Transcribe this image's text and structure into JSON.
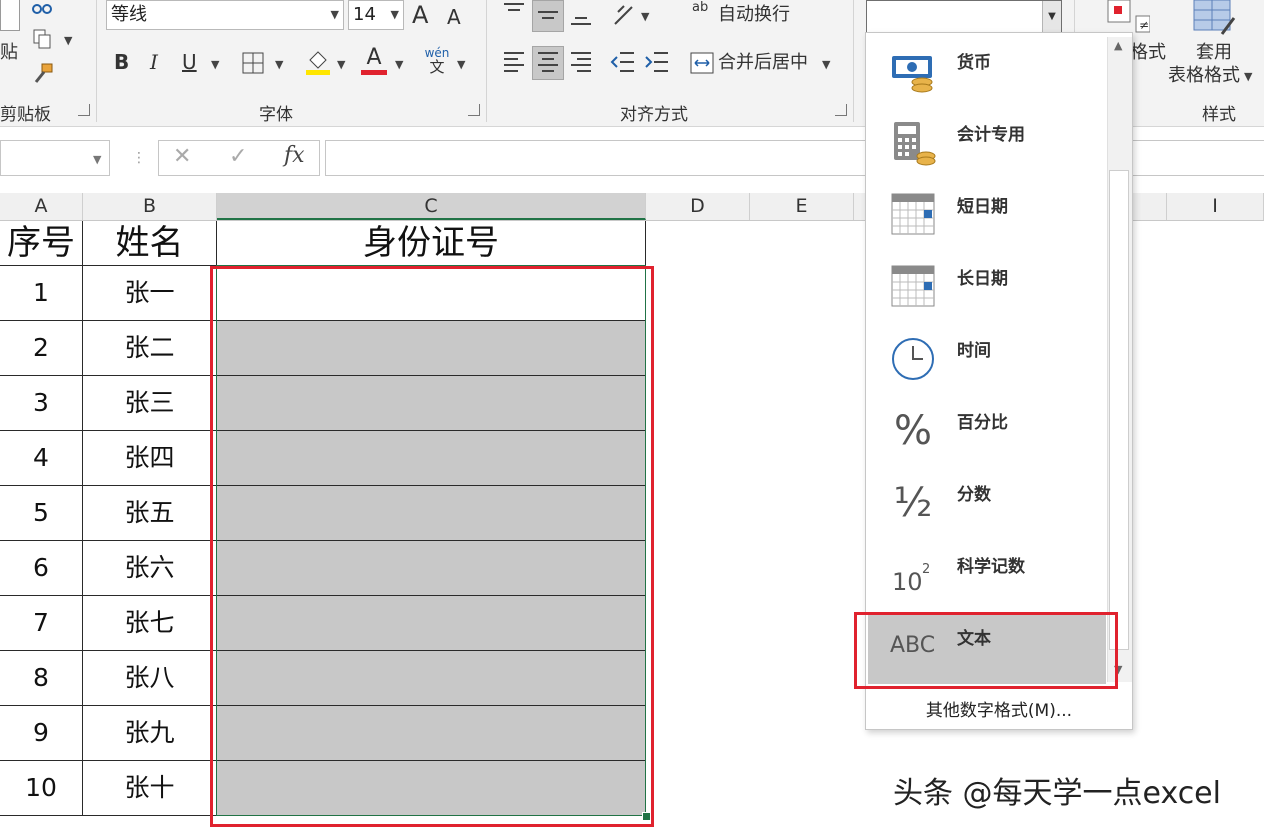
{
  "ribbon": {
    "clipboard": {
      "paste_label": "贴",
      "group_label": "剪贴板"
    },
    "font": {
      "font_name": "等线",
      "font_size": "14",
      "group_label": "字体",
      "bold": "B",
      "italic": "I",
      "underline": "U",
      "grow": "A",
      "shrink": "A",
      "font_color_letter": "A",
      "phonetic_top": "wén",
      "phonetic_bottom": "文"
    },
    "alignment": {
      "wrap_text": "自动换行",
      "merge_center": "合并后居中",
      "group_label": "对齐方式",
      "wrap_icon_text": "ab"
    },
    "styles": {
      "conditional_partial": "格式",
      "table_format_line1": "套用",
      "table_format_line2": "表格格式",
      "group_label": "样式"
    }
  },
  "formula_bar": {
    "cancel": "✕",
    "enter": "✓",
    "fx": "fx"
  },
  "columns": [
    "A",
    "B",
    "C",
    "D",
    "E",
    "I"
  ],
  "table": {
    "headers": [
      "序号",
      "姓名",
      "身份证号"
    ],
    "rows": [
      {
        "no": "1",
        "name": "张一"
      },
      {
        "no": "2",
        "name": "张二"
      },
      {
        "no": "3",
        "name": "张三"
      },
      {
        "no": "4",
        "name": "张四"
      },
      {
        "no": "5",
        "name": "张五"
      },
      {
        "no": "6",
        "name": "张六"
      },
      {
        "no": "7",
        "name": "张七"
      },
      {
        "no": "8",
        "name": "张八"
      },
      {
        "no": "9",
        "name": "张九"
      },
      {
        "no": "10",
        "name": "张十"
      }
    ]
  },
  "number_format_menu": {
    "items": [
      {
        "label": "货币",
        "icon": "currency-icon"
      },
      {
        "label": "会计专用",
        "icon": "accounting-icon"
      },
      {
        "label": "短日期",
        "icon": "short-date-icon"
      },
      {
        "label": "长日期",
        "icon": "long-date-icon"
      },
      {
        "label": "时间",
        "icon": "clock-icon"
      },
      {
        "label": "百分比",
        "icon": "percent-icon",
        "glyph": "%"
      },
      {
        "label": "分数",
        "icon": "fraction-icon",
        "glyph": "½"
      },
      {
        "label": "科学记数",
        "icon": "scientific-icon",
        "glyph": "10",
        "sup": "2"
      },
      {
        "label": "文本",
        "icon": "text-format-icon",
        "glyph": "ABC"
      }
    ],
    "more_formats": "其他数字格式(M)...",
    "selected": "文本"
  },
  "watermark": "头条 @每天学一点excel",
  "colors": {
    "accent_red": "#e0222e",
    "excel_green": "#217346",
    "selection_grey": "#c8c8c8"
  }
}
